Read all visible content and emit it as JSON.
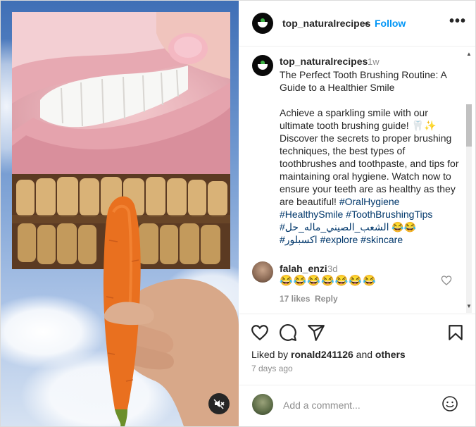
{
  "header": {
    "username": "top_naturalrecipes",
    "separator": "•",
    "follow_label": "Follow",
    "more_icon": "more-horizontal-icon"
  },
  "caption": {
    "username": "top_naturalrecipes",
    "time": "1w",
    "title": "The Perfect Tooth Brushing Routine: A Guide to a Healthier Smile",
    "body": "Achieve a sparkling smile with our ultimate tooth brushing guide! 🦷✨ Discover the secrets to proper brushing techniques, the best types of toothbrushes and toothpaste, and tips for maintaining oral hygiene. Watch now to ensure your teeth are as healthy as they are beautiful!",
    "hashtags_line1": "#OralHygiene #HealthySmile #ToothBrushingTips",
    "hashtags_line2": "#الشعب_الصيني_ماله_حل 😂😂",
    "hashtags_line3": "#اكسبلور #explore #skincare"
  },
  "comment": {
    "username": "falah_enzi",
    "time": "3d",
    "text": "😂😂😂😂😂😂😂",
    "likes": "17 likes",
    "reply_label": "Reply"
  },
  "actions": {
    "icons": [
      "heart-icon",
      "comment-icon",
      "share-icon",
      "bookmark-icon"
    ],
    "liked_by_prefix": "Liked by",
    "liked_by_user": "ronald241126",
    "liked_by_and": "and",
    "liked_by_others": "others",
    "date": "7 days ago"
  },
  "add_comment": {
    "placeholder": "Add a comment...",
    "emoji_icon": "emoji-icon"
  },
  "media": {
    "mute_icon": "volume-muted-icon"
  },
  "colors": {
    "accent": "#0095f6",
    "text": "#262626",
    "muted": "#8e8e8e",
    "hashtag": "#00376b"
  }
}
